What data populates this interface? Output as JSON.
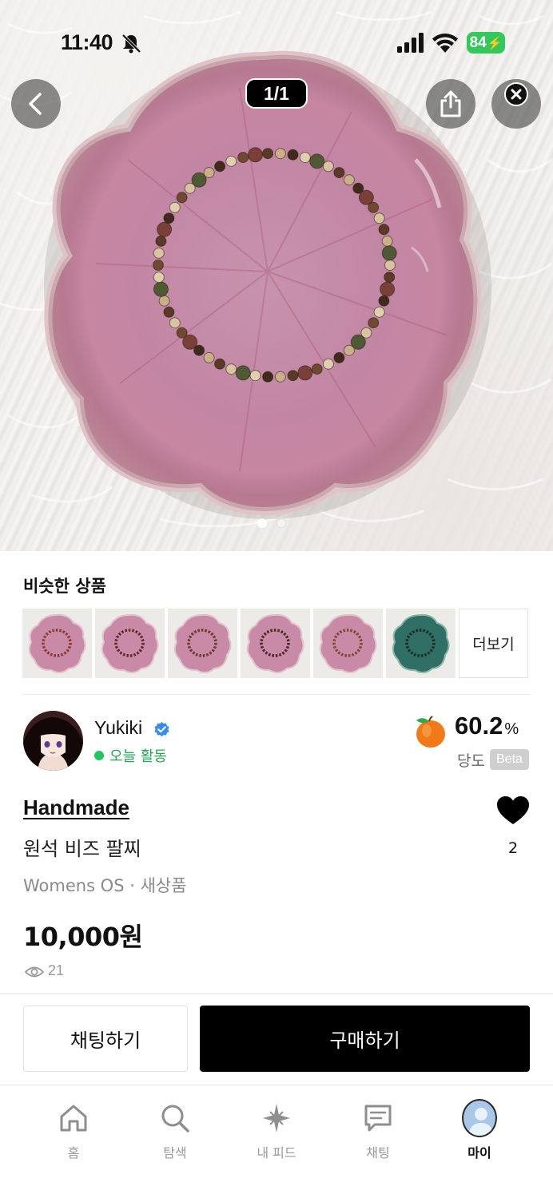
{
  "status_bar": {
    "time": "11:40",
    "battery": "84"
  },
  "gallery": {
    "counter": "1/1",
    "dot_count": 2,
    "active_dot": 0
  },
  "similar": {
    "title": "비슷한 상품",
    "more_label": "더보기",
    "items": [
      "pink dish bracelet",
      "pink dish bracelet",
      "pink dish bracelet",
      "pink dish bracelet",
      "pink dish bracelet",
      "teal dish bracelet"
    ]
  },
  "seller": {
    "name": "Yukiki",
    "activity": "오늘 활동",
    "sweetness_value": "60.2",
    "sweetness_unit": "%",
    "sweetness_label": "당도",
    "beta": "Beta"
  },
  "product": {
    "brand": "Handmade",
    "name": "원석 비즈 팔찌",
    "meta": "Womens OS · 새상품",
    "price": "10,000원",
    "views": "21",
    "likes": "2"
  },
  "actions": {
    "chat": "채팅하기",
    "buy": "구매하기"
  },
  "tabbar": {
    "items": [
      {
        "label": "홈",
        "icon": "home-icon"
      },
      {
        "label": "탐색",
        "icon": "search-icon"
      },
      {
        "label": "내 피드",
        "icon": "sparkle-icon"
      },
      {
        "label": "채팅",
        "icon": "chat-bubble-icon"
      },
      {
        "label": "마이",
        "icon": "profile-avatar"
      }
    ],
    "active_index": 4
  },
  "colors": {
    "accent_green": "#22c55e",
    "battery_green": "#34c759",
    "verified_blue": "#3b8ee8",
    "buy_button": "#000000",
    "dish_pink": "#c98aa8"
  }
}
